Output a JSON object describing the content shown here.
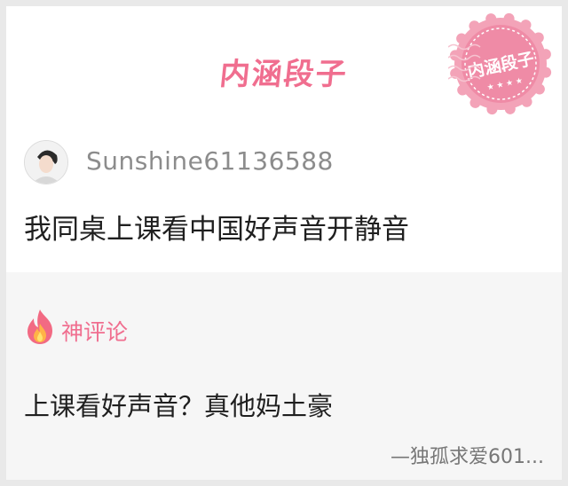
{
  "header": {
    "title": "内涵段子",
    "stamp_text": "内涵段子",
    "brand_color": "#f06e8f"
  },
  "post": {
    "username": "Sunshine61136588",
    "text": "我同桌上课看中国好声音开静音"
  },
  "comment_section": {
    "label": "神评论",
    "label_icon": "flame-icon",
    "text": "上课看好声音？真他妈土豪",
    "author": "—独孤求爱601..."
  },
  "colors": {
    "accent": "#f06e8f",
    "comment_bg": "#f6f6f6",
    "text_primary": "#1f1f1f",
    "text_secondary": "#8c8c8c"
  }
}
